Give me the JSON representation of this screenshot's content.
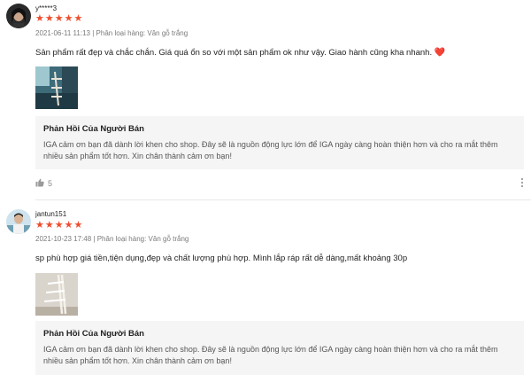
{
  "reviews": [
    {
      "username": "y*****3",
      "rating": 5,
      "timestamp": "2021-06-11 11:13",
      "variation_label": "Phân loại hàng: Vân gỗ trắng",
      "content": "Sản phẩm rất đẹp và chắc chắn. Giá quá ổn so với một sản phẩm ok như vậy. Giao hành cũng kha nhanh.",
      "emoji": "❤️",
      "seller_reply_title": "Phản Hồi Của Người Bán",
      "seller_reply_text_1": "IGA cảm ơn bạn đã dành lời khen cho shop. Đây sẽ là nguồn động lực lớn để IGA ngày càng hoàn thiện hơn và cho ra mắt thêm",
      "seller_reply_text_2": "nhiều sản phẩm tốt hơn. Xin chân thành cảm ơn bạn!",
      "likes": "5"
    },
    {
      "username": "jantun151",
      "rating": 5,
      "timestamp": "2021-10-23 17:48",
      "variation_label": "Phân loại hàng: Vân gỗ trắng",
      "content": "sp phù hợp giá tiền,tiện dụng,đẹp và chất lượng phù hợp. Mình lắp ráp rất dễ dàng,mất khoảng 30p",
      "seller_reply_title": "Phản Hồi Của Người Bán",
      "seller_reply_text_1": "IGA cảm ơn bạn đã dành lời khen cho shop. Đây sẽ là nguồn động lực lớn để IGA ngày càng hoàn thiện hơn và cho ra mắt thêm",
      "seller_reply_text_2": "nhiều sản phẩm tốt hơn. Xin chân thành cảm ơn bạn!"
    }
  ],
  "separator": "|",
  "colors": {
    "star": "#ee4d2d",
    "reply_bg": "#f5f5f5",
    "meta": "#7a7a7a"
  },
  "icons": {
    "star": "star-icon",
    "like": "thumbs-up-icon",
    "more": "more-vertical-icon"
  }
}
